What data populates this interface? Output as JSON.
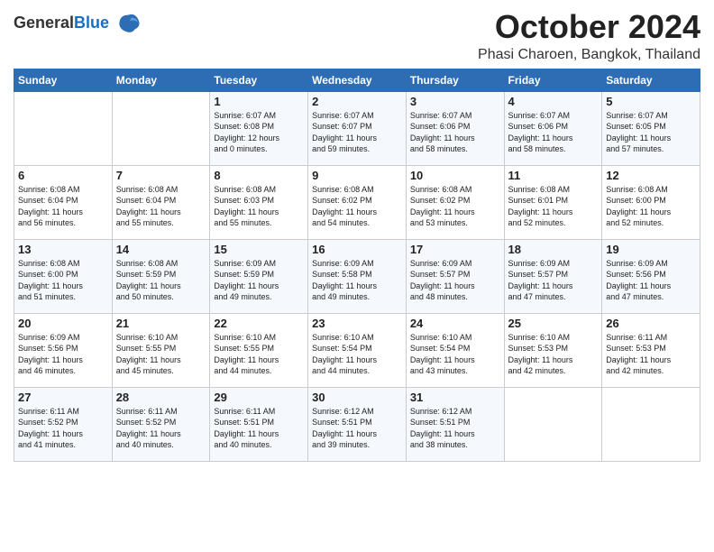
{
  "header": {
    "logo_general": "General",
    "logo_blue": "Blue",
    "month": "October 2024",
    "location": "Phasi Charoen, Bangkok, Thailand"
  },
  "weekdays": [
    "Sunday",
    "Monday",
    "Tuesday",
    "Wednesday",
    "Thursday",
    "Friday",
    "Saturday"
  ],
  "weeks": [
    [
      {
        "day": "",
        "info": ""
      },
      {
        "day": "",
        "info": ""
      },
      {
        "day": "1",
        "info": "Sunrise: 6:07 AM\nSunset: 6:08 PM\nDaylight: 12 hours\nand 0 minutes."
      },
      {
        "day": "2",
        "info": "Sunrise: 6:07 AM\nSunset: 6:07 PM\nDaylight: 11 hours\nand 59 minutes."
      },
      {
        "day": "3",
        "info": "Sunrise: 6:07 AM\nSunset: 6:06 PM\nDaylight: 11 hours\nand 58 minutes."
      },
      {
        "day": "4",
        "info": "Sunrise: 6:07 AM\nSunset: 6:06 PM\nDaylight: 11 hours\nand 58 minutes."
      },
      {
        "day": "5",
        "info": "Sunrise: 6:07 AM\nSunset: 6:05 PM\nDaylight: 11 hours\nand 57 minutes."
      }
    ],
    [
      {
        "day": "6",
        "info": "Sunrise: 6:08 AM\nSunset: 6:04 PM\nDaylight: 11 hours\nand 56 minutes."
      },
      {
        "day": "7",
        "info": "Sunrise: 6:08 AM\nSunset: 6:04 PM\nDaylight: 11 hours\nand 55 minutes."
      },
      {
        "day": "8",
        "info": "Sunrise: 6:08 AM\nSunset: 6:03 PM\nDaylight: 11 hours\nand 55 minutes."
      },
      {
        "day": "9",
        "info": "Sunrise: 6:08 AM\nSunset: 6:02 PM\nDaylight: 11 hours\nand 54 minutes."
      },
      {
        "day": "10",
        "info": "Sunrise: 6:08 AM\nSunset: 6:02 PM\nDaylight: 11 hours\nand 53 minutes."
      },
      {
        "day": "11",
        "info": "Sunrise: 6:08 AM\nSunset: 6:01 PM\nDaylight: 11 hours\nand 52 minutes."
      },
      {
        "day": "12",
        "info": "Sunrise: 6:08 AM\nSunset: 6:00 PM\nDaylight: 11 hours\nand 52 minutes."
      }
    ],
    [
      {
        "day": "13",
        "info": "Sunrise: 6:08 AM\nSunset: 6:00 PM\nDaylight: 11 hours\nand 51 minutes."
      },
      {
        "day": "14",
        "info": "Sunrise: 6:08 AM\nSunset: 5:59 PM\nDaylight: 11 hours\nand 50 minutes."
      },
      {
        "day": "15",
        "info": "Sunrise: 6:09 AM\nSunset: 5:59 PM\nDaylight: 11 hours\nand 49 minutes."
      },
      {
        "day": "16",
        "info": "Sunrise: 6:09 AM\nSunset: 5:58 PM\nDaylight: 11 hours\nand 49 minutes."
      },
      {
        "day": "17",
        "info": "Sunrise: 6:09 AM\nSunset: 5:57 PM\nDaylight: 11 hours\nand 48 minutes."
      },
      {
        "day": "18",
        "info": "Sunrise: 6:09 AM\nSunset: 5:57 PM\nDaylight: 11 hours\nand 47 minutes."
      },
      {
        "day": "19",
        "info": "Sunrise: 6:09 AM\nSunset: 5:56 PM\nDaylight: 11 hours\nand 47 minutes."
      }
    ],
    [
      {
        "day": "20",
        "info": "Sunrise: 6:09 AM\nSunset: 5:56 PM\nDaylight: 11 hours\nand 46 minutes."
      },
      {
        "day": "21",
        "info": "Sunrise: 6:10 AM\nSunset: 5:55 PM\nDaylight: 11 hours\nand 45 minutes."
      },
      {
        "day": "22",
        "info": "Sunrise: 6:10 AM\nSunset: 5:55 PM\nDaylight: 11 hours\nand 44 minutes."
      },
      {
        "day": "23",
        "info": "Sunrise: 6:10 AM\nSunset: 5:54 PM\nDaylight: 11 hours\nand 44 minutes."
      },
      {
        "day": "24",
        "info": "Sunrise: 6:10 AM\nSunset: 5:54 PM\nDaylight: 11 hours\nand 43 minutes."
      },
      {
        "day": "25",
        "info": "Sunrise: 6:10 AM\nSunset: 5:53 PM\nDaylight: 11 hours\nand 42 minutes."
      },
      {
        "day": "26",
        "info": "Sunrise: 6:11 AM\nSunset: 5:53 PM\nDaylight: 11 hours\nand 42 minutes."
      }
    ],
    [
      {
        "day": "27",
        "info": "Sunrise: 6:11 AM\nSunset: 5:52 PM\nDaylight: 11 hours\nand 41 minutes."
      },
      {
        "day": "28",
        "info": "Sunrise: 6:11 AM\nSunset: 5:52 PM\nDaylight: 11 hours\nand 40 minutes."
      },
      {
        "day": "29",
        "info": "Sunrise: 6:11 AM\nSunset: 5:51 PM\nDaylight: 11 hours\nand 40 minutes."
      },
      {
        "day": "30",
        "info": "Sunrise: 6:12 AM\nSunset: 5:51 PM\nDaylight: 11 hours\nand 39 minutes."
      },
      {
        "day": "31",
        "info": "Sunrise: 6:12 AM\nSunset: 5:51 PM\nDaylight: 11 hours\nand 38 minutes."
      },
      {
        "day": "",
        "info": ""
      },
      {
        "day": "",
        "info": ""
      }
    ]
  ]
}
